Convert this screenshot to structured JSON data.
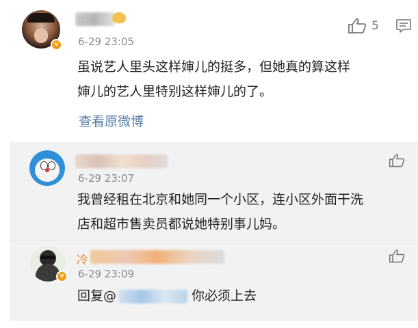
{
  "main_comment": {
    "username": "猫捏",
    "timestamp": "6-29 23:05",
    "text_line1": "虽说艺人里头这样婶儿的挺多，但她真的算这样",
    "text_line2": "婶儿的艺人里特别这样婶儿的了。",
    "view_original": "查看原微博",
    "like_count": "5",
    "badge": "v"
  },
  "replies": [
    {
      "timestamp": "6-29 23:07",
      "text_line1": "我曾经租在北京和她同一个小区，连小区外面干洗",
      "text_line2": "店和超市售卖员都说她特别事儿妈。"
    },
    {
      "username": "冷",
      "timestamp": "6-29 23:09",
      "reply_prefix": "回复@",
      "reply_text": "你必须上去",
      "badge": "v"
    }
  ]
}
